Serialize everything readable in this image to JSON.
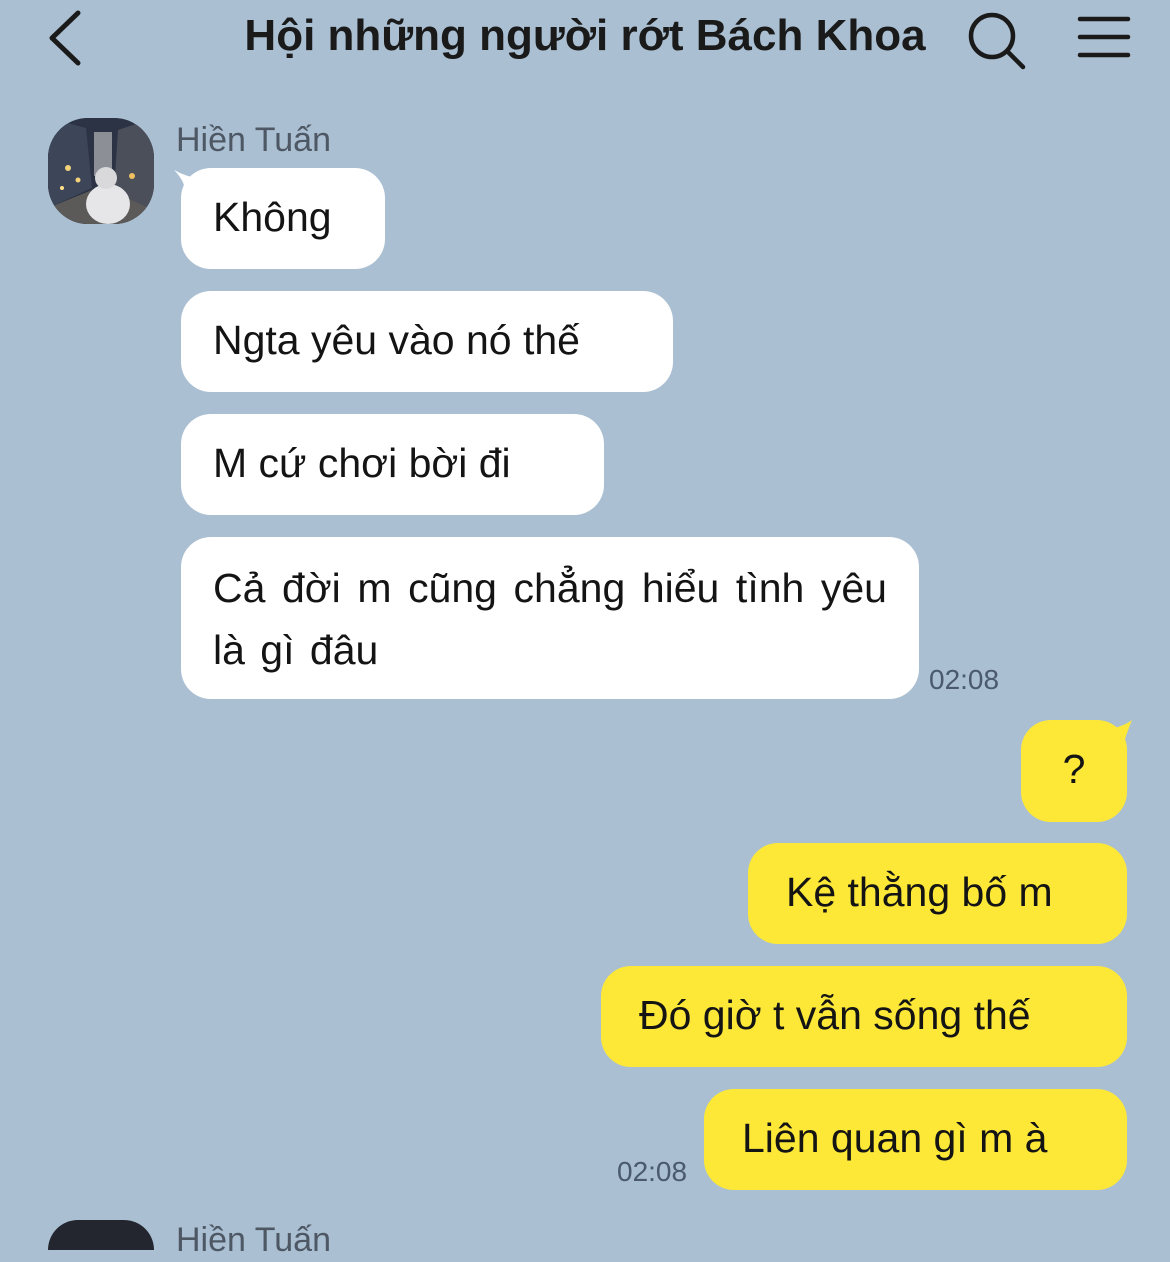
{
  "header": {
    "title": "Hội những người rớt Bách Khoa"
  },
  "icons": {
    "back": "chevron-left-icon",
    "search": "search-icon",
    "menu": "hamburger-menu-icon"
  },
  "colors": {
    "background": "#aabfd2",
    "incoming_bubble": "#ffffff",
    "outgoing_bubble": "#fde838"
  },
  "chat": {
    "incoming_group": {
      "sender": "Hiền Tuấn",
      "messages": [
        "Không",
        "Ngta yêu vào nó thế",
        "M cứ chơi bời đi",
        "Cả đời m cũng chẳng hiểu tình yêu là gì đâu"
      ],
      "time": "02:08"
    },
    "outgoing_group": {
      "messages": [
        "?",
        "Kệ thằng bố m",
        "Đó giờ t vẫn sống thế",
        "Liên quan gì m à"
      ],
      "time": "02:08"
    },
    "next_sender_partial": "Hiền Tuấn"
  }
}
